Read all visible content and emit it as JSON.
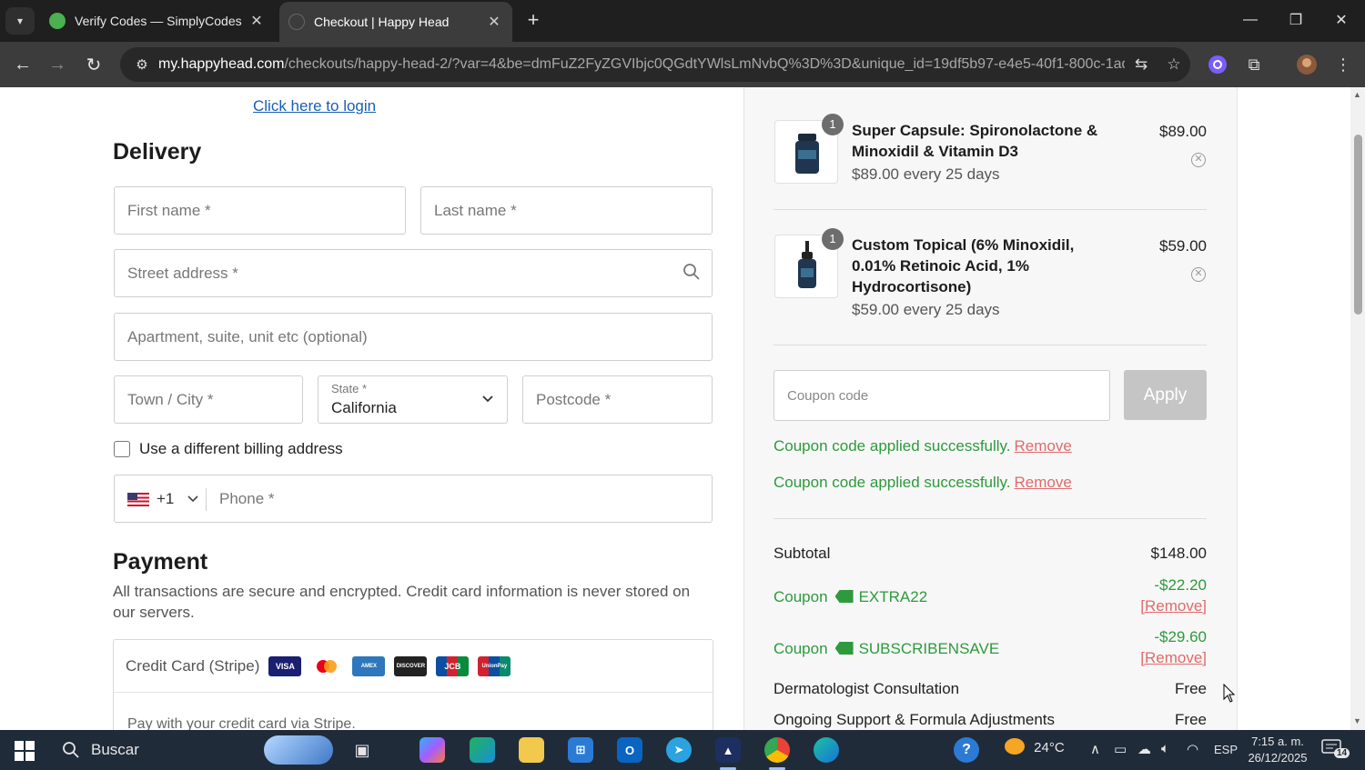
{
  "browser": {
    "tabs": [
      {
        "title": "Verify Codes — SimplyCodes",
        "active": false
      },
      {
        "title": "Checkout | Happy Head",
        "active": true
      }
    ],
    "url_host": "my.happyhead.com",
    "url_path": "/checkouts/happy-head-2/?var=4&be=dmFuZ2FyZGVIbjc0QGdtYWlsLmNvbQ%3D%3D&unique_id=19df5b97-e4e5-40f1-800c-1ad8..."
  },
  "delivery": {
    "login_link": "Click here to login",
    "heading": "Delivery",
    "first_name_placeholder": "First name *",
    "last_name_placeholder": "Last name *",
    "street_placeholder": "Street address *",
    "apartment_placeholder": "Apartment, suite, unit etc (optional)",
    "city_placeholder": "Town / City *",
    "state_label": "State *",
    "state_value": "California",
    "postcode_placeholder": "Postcode *",
    "billing_checkbox_label": "Use a different billing address",
    "phone_country_code": "+1",
    "phone_placeholder": "Phone *"
  },
  "payment": {
    "heading": "Payment",
    "description": "All transactions are secure and encrypted. Credit card information is never stored on our servers.",
    "method_label": "Credit Card (Stripe)",
    "cards": [
      "VISA",
      "Mastercard",
      "American Express",
      "Discover",
      "JCB",
      "UnionPay"
    ],
    "stripe_sub": "Pay with your credit card via Stripe."
  },
  "order": {
    "items": [
      {
        "qty": "1",
        "name_line1": "Super Capsule: Spironolactone &",
        "name_line2": "Minoxidil & Vitamin D3",
        "name_line3": "",
        "subscription": "$89.00 every 25 days",
        "price": "$89.00"
      },
      {
        "qty": "1",
        "name_line1": "Custom Topical (6% Minoxidil,",
        "name_line2": "0.01% Retinoic Acid, 1%",
        "name_line3": "Hydrocortisone)",
        "subscription": "$59.00 every 25 days",
        "price": "$59.00"
      }
    ],
    "coupon_placeholder": "Coupon code",
    "apply_label": "Apply",
    "coupon_messages": [
      {
        "text": "Coupon code applied successfully.",
        "remove": "Remove"
      },
      {
        "text": "Coupon code applied successfully.",
        "remove": "Remove"
      }
    ],
    "subtotal_label": "Subtotal",
    "subtotal_value": "$148.00",
    "coupons": [
      {
        "label": "Coupon",
        "code": "EXTRA22",
        "amount": "-$22.20",
        "remove": "[Remove]"
      },
      {
        "label": "Coupon",
        "code": "SUBSCRIBENSAVE",
        "amount": "-$29.60",
        "remove": "[Remove]"
      }
    ],
    "consultation_label": "Dermatologist Consultation",
    "consultation_value": "Free",
    "support_label": "Ongoing Support & Formula Adjustments",
    "support_value": "Free"
  },
  "taskbar": {
    "search_label": "Buscar",
    "temperature": "24°C",
    "language": "ESP",
    "time": "7:15 a. m.",
    "date": "26/12/2025",
    "notification_count": "14"
  },
  "colors": {
    "accent_green": "#2e9a3d",
    "remove_red": "#e06b6b",
    "link_blue": "#1a5fb4"
  }
}
